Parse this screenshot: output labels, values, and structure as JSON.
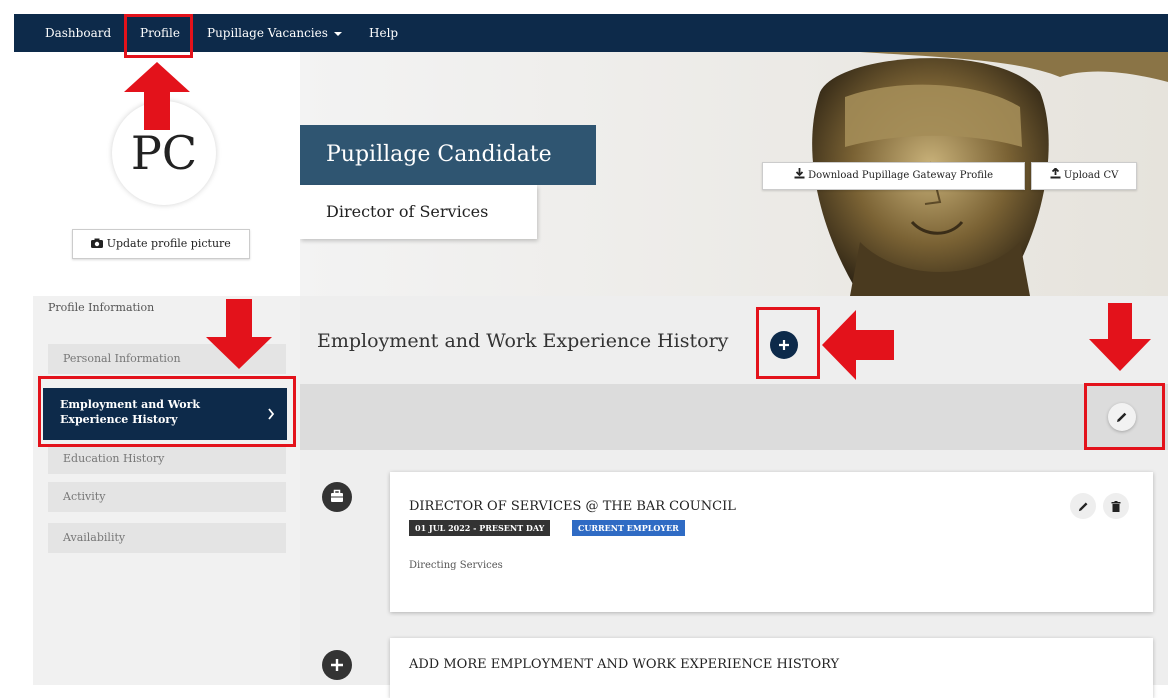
{
  "nav": {
    "items": [
      "Dashboard",
      "Profile",
      "Pupillage Vacancies",
      "Help"
    ]
  },
  "sidebar": {
    "avatar_initials": "PC",
    "update_picture_label": "Update profile picture",
    "heading": "Profile Information",
    "items": [
      {
        "label": "Personal Information",
        "active": false
      },
      {
        "label_line1": "Employment and Work",
        "label_line2": "Experience History",
        "active": true
      },
      {
        "label": "Education History",
        "active": false
      },
      {
        "label": "Activity",
        "active": false
      },
      {
        "label": "Availability",
        "active": false
      }
    ]
  },
  "profile": {
    "name": "Pupillage Candidate",
    "job_title": "Director of Services",
    "download_label": "Download Pupillage Gateway Profile",
    "upload_label": "Upload CV"
  },
  "section": {
    "title": "Employment and Work Experience History"
  },
  "entries": [
    {
      "title": "DIRECTOR OF SERVICES @ THE BAR COUNCIL",
      "date_badge": "01 JUL 2022 - PRESENT DAY",
      "status_badge": "CURRENT EMPLOYER",
      "description": "Directing Services"
    }
  ],
  "add_more_label": "ADD MORE EMPLOYMENT AND WORK EXPERIENCE HISTORY",
  "colors": {
    "navy": "#0d2a4a",
    "title_box": "#2f5571",
    "highlight_red": "#e3121b",
    "date_badge": "#333333",
    "status_badge": "#2f6bc4"
  }
}
